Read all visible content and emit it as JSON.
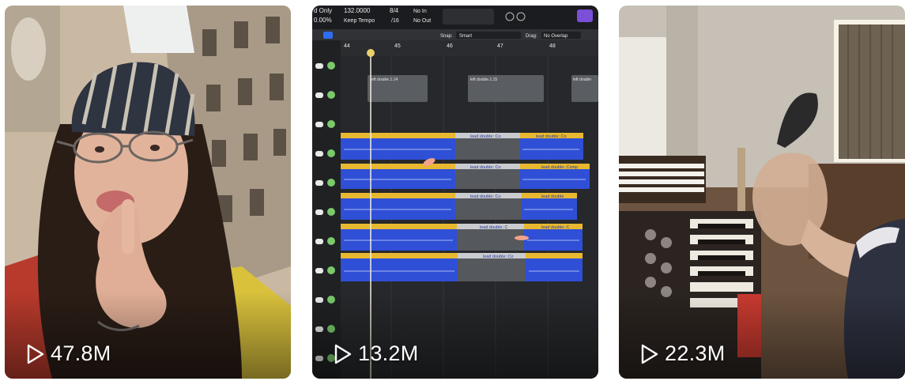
{
  "videos": [
    {
      "views": "47.8M",
      "icon": "play-outline-icon"
    },
    {
      "views": "13.2M",
      "icon": "play-outline-icon"
    },
    {
      "views": "22.3M",
      "icon": "play-outline-icon"
    }
  ],
  "daw": {
    "mode_only": "d Only",
    "percent": "0.00%",
    "tempo": "132.0000",
    "keep_tempo": "Keep Tempo",
    "time_sig": "8/4",
    "division": "/16",
    "no_in": "No In",
    "no_out": "No Out",
    "snap_label": "Snap:",
    "snap_value": "Smart",
    "drag_label": "Drag:",
    "drag_value": "No Overlap",
    "bars": [
      "44",
      "45",
      "46",
      "47",
      "48"
    ],
    "region_top_1": "left double.1.14",
    "region_top_2": "left double.1.15",
    "region_top_3": "left double",
    "region_lead_a": "lead double: Co",
    "region_lead_b": "lead double: Co",
    "region_lead_c": "lead double: Comp",
    "region_lead_d": "lead double",
    "region_lead_e": "lead double: C",
    "region_lead_f": "lead double: Co"
  },
  "colors": {
    "region_blue": "#2f4fd6",
    "region_header": "#e8b830",
    "daw_bg": "#26282b"
  }
}
